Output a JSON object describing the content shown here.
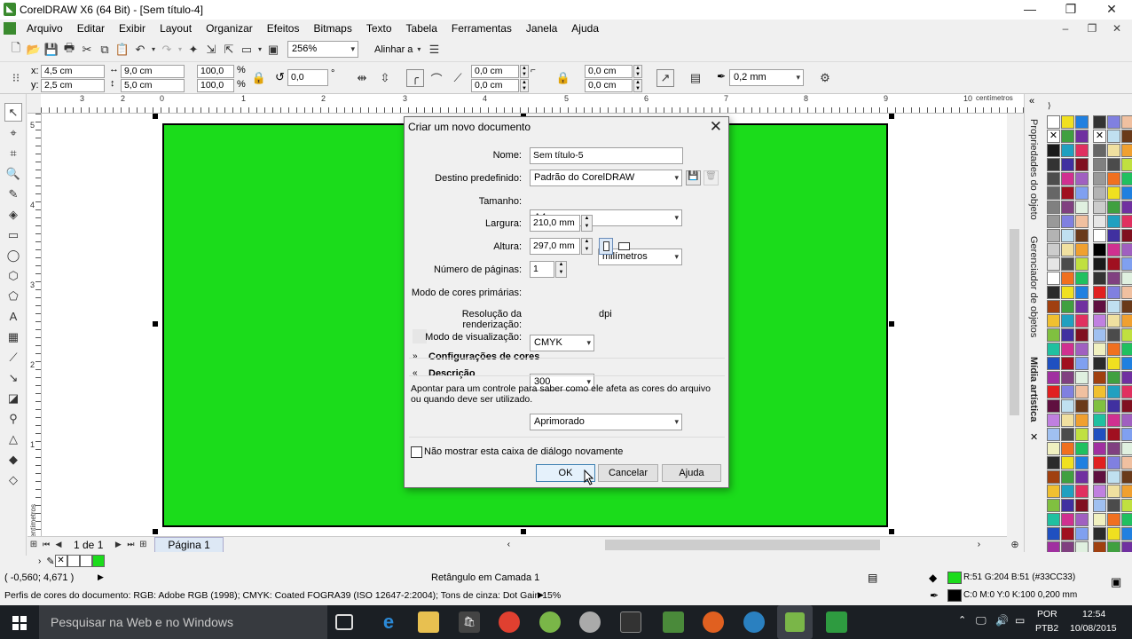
{
  "window": {
    "title": "CorelDRAW X6 (64 Bit) - [Sem título-4]",
    "min": "—",
    "max": "❐",
    "close": "✕"
  },
  "menu": [
    "Arquivo",
    "Editar",
    "Exibir",
    "Layout",
    "Organizar",
    "Efeitos",
    "Bitmaps",
    "Texto",
    "Tabela",
    "Ferramentas",
    "Janela",
    "Ajuda"
  ],
  "toolbar": {
    "zoom": "256%",
    "align": "Alinhar a"
  },
  "property_bar": {
    "x": "4,5 cm",
    "y": "2,5 cm",
    "x_label": "x:",
    "y_label": "y:",
    "width": "9,0 cm",
    "height": "5,0 cm",
    "scale_w": "100,0",
    "scale_h": "100,0",
    "pct": "%",
    "rotation": "0,0",
    "rotation_unit": "°",
    "corner1": "0,0 cm",
    "corner2": "0,0 cm",
    "corner3": "0,0 cm",
    "corner4": "0,0 cm",
    "outline": "0,2 mm"
  },
  "ruler": {
    "unit": "centímetros",
    "h_ticks": [
      "3",
      "2",
      "1",
      "0",
      "1",
      "2",
      "3",
      "4",
      "5",
      "6",
      "7",
      "8",
      "9",
      "10"
    ],
    "v_ticks": [
      "5",
      "4",
      "3",
      "2",
      "1"
    ],
    "v_unit": "centímetros"
  },
  "docker_tabs": [
    "Propriedades do objeto",
    "Gerenciador de objetos",
    "Mídia artística"
  ],
  "dialog": {
    "title": "Criar um novo documento",
    "name_label": "Nome:",
    "name_value": "Sem título-5",
    "preset_label": "Destino predefinido:",
    "preset_value": "Padrão do CorelDRAW",
    "size_label": "Tamanho:",
    "size_value": "A4",
    "width_label": "Largura:",
    "width_value": "210,0 mm",
    "unit_value": "milímetros",
    "height_label": "Altura:",
    "height_value": "297,0 mm",
    "pages_label": "Número de páginas:",
    "pages_value": "1",
    "color_mode_label": "Modo de cores primárias:",
    "color_mode_value": "CMYK",
    "resolution_label": "Resolução da renderização:",
    "resolution_value": "300",
    "resolution_unit": "dpi",
    "preview_label": "Modo de visualização:",
    "preview_value": "Aprimorado",
    "color_settings": "Configurações de cores",
    "description_header": "Descrição",
    "description_text": "Apontar para um controle para saber como ele afeta as cores do arquivo ou quando deve ser utilizado.",
    "dont_show": "Não mostrar esta caixa de diálogo novamente",
    "ok": "OK",
    "cancel": "Cancelar",
    "help": "Ajuda"
  },
  "pagebar": {
    "page_count": "1 de 1",
    "page_tab": "Página 1"
  },
  "status": {
    "coords": "( -0,560; 4,671 )",
    "object": "Retângulo em Camada 1",
    "fill": "R:51 G:204 B:51 (#33CC33)",
    "outline": "C:0 M:0 Y:0 K:100  0,200 mm",
    "profile": "Perfis de cores do documento: RGB: Adobe RGB (1998); CMYK: Coated FOGRA39 (ISO 12647-2:2004); Tons de cinza: Dot Gain 15%",
    "fill_color": "#1bdc1b"
  },
  "taskbar": {
    "search": "Pesquisar na Web e no Windows",
    "lang1": "POR",
    "lang2": "PTB2",
    "time": "12:54",
    "date": "10/08/2015"
  },
  "colors": {
    "palette": [
      "#2b2b2b",
      "#4b4b4b",
      "#6a3a1a",
      "#a04010",
      "#f07020",
      "#f0a030",
      "#f0c030",
      "#f0e020",
      "#c0e040",
      "#80c040",
      "#40a040",
      "#20c060",
      "#20c0a0",
      "#20a0c0",
      "#2080e0",
      "#2050c0",
      "#4030a0",
      "#7030a0",
      "#a030a0",
      "#d03090",
      "#e03060",
      "#e02020",
      "#a01020",
      "#801020",
      "#601040",
      "#804080",
      "#a060c0",
      "#c080e0",
      "#8080e0",
      "#80a0f0",
      "#a0c0f0",
      "#c0e0f0",
      "#e0f0e0",
      "#f0f0c0",
      "#f0e0a0",
      "#f0c0a0"
    ]
  }
}
